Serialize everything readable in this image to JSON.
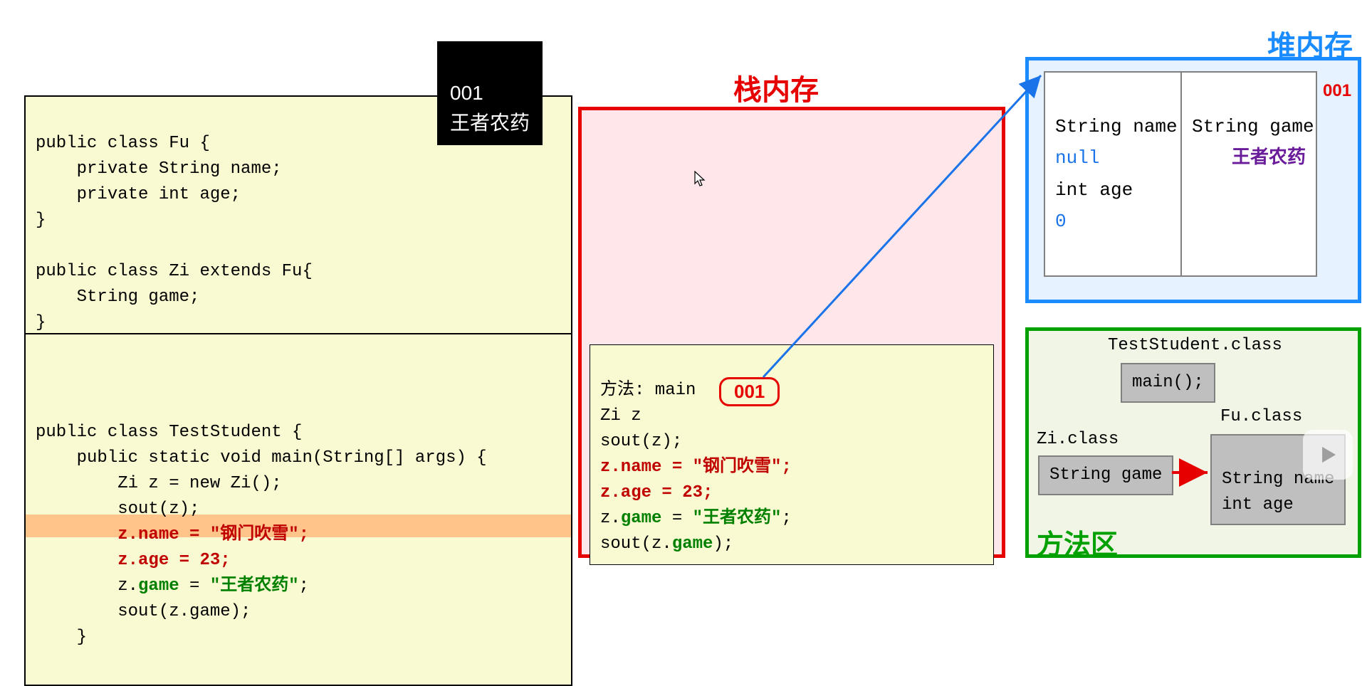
{
  "tooltip": {
    "line1": "001",
    "line2": "王者农药"
  },
  "code_top": {
    "l1": "public class Fu {",
    "l2": "    private String name;",
    "l3": "    private int age;",
    "l4": "}",
    "l5": "",
    "l6": "public class Zi extends Fu{",
    "l7": "    String game;",
    "l8": "}"
  },
  "code_bottom": {
    "l1": "public class TestStudent {",
    "l2": "    public static void main(String[] args) {",
    "l3": "        Zi z = new Zi();",
    "l4": "        sout(z);",
    "l5a": "        ",
    "l5b": "z.name = ",
    "l5c": "\"钢门吹雪\"",
    "l5d": ";",
    "l6a": "        ",
    "l6b": "z.age = ",
    "l6c": "23",
    "l6d": ";",
    "l7a": "        z.",
    "l7b": "game",
    "l7c": " = ",
    "l7d": "\"王者农药\"",
    "l7e": ";",
    "l8": "        sout(z.game);",
    "l9": "    }"
  },
  "stack": {
    "title": "栈内存",
    "frame": {
      "l1": "方法: main",
      "l2": "Zi z",
      "l3": "sout(z);",
      "l4a": "z.name = ",
      "l4b": "\"钢门吹雪\"",
      "l4c": ";",
      "l5a": "z.age = ",
      "l5b": "23",
      "l5c": ";",
      "l6a": "z.",
      "l6b": "game",
      "l6c": " = ",
      "l6d": "\"王者农药\"",
      "l6e": ";",
      "l7a": "sout(z.",
      "l7b": "game",
      "l7c": ");"
    },
    "addr": "001"
  },
  "heap": {
    "title": "堆内存",
    "addr": "001",
    "col1": {
      "l1": "String name",
      "l2": "null",
      "l3": "int age",
      "l4": "0"
    },
    "col2": {
      "l1": "String game",
      "l2": "王者农药"
    }
  },
  "method_area": {
    "title": "方法区",
    "teststudent_label": "TestStudent.class",
    "main_box": "main();",
    "zi_label": "Zi.class",
    "zi_box": "String game",
    "fu_label": "Fu.class",
    "fu_box_l1": "String name",
    "fu_box_l2": "int age"
  }
}
